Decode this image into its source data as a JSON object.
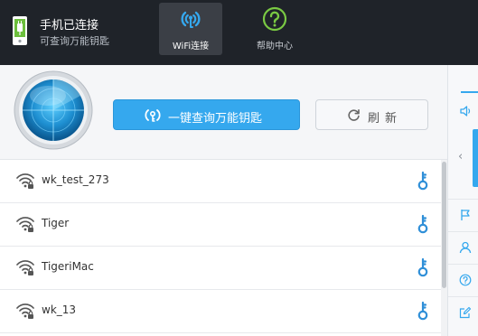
{
  "status": {
    "title": "手机已连接",
    "subtitle": "可查询万能钥匙",
    "icon": "phone-connected-icon"
  },
  "nav": {
    "tabs": [
      {
        "label": "WiFi连接",
        "icon": "wifi-signal-icon",
        "active": true
      },
      {
        "label": "帮助中心",
        "icon": "question-icon",
        "active": false
      }
    ]
  },
  "actions": {
    "query_label": "一键查询万能钥匙",
    "refresh_label": "刷新"
  },
  "networks": [
    {
      "ssid": "wk_test_273",
      "icon": "wifi-lock-icon",
      "key_icon": "key-icon"
    },
    {
      "ssid": "Tiger",
      "icon": "wifi-lock-icon",
      "key_icon": "key-icon"
    },
    {
      "ssid": "TigeriMac",
      "icon": "wifi-lock-icon",
      "key_icon": "key-icon"
    },
    {
      "ssid": "wk_13",
      "icon": "wifi-lock-icon",
      "key_icon": "key-icon"
    }
  ],
  "colors": {
    "topbar": "#1f2329",
    "accent": "#35a8ee",
    "key": "#2f8fd8",
    "help_icon": "#7ac943"
  }
}
